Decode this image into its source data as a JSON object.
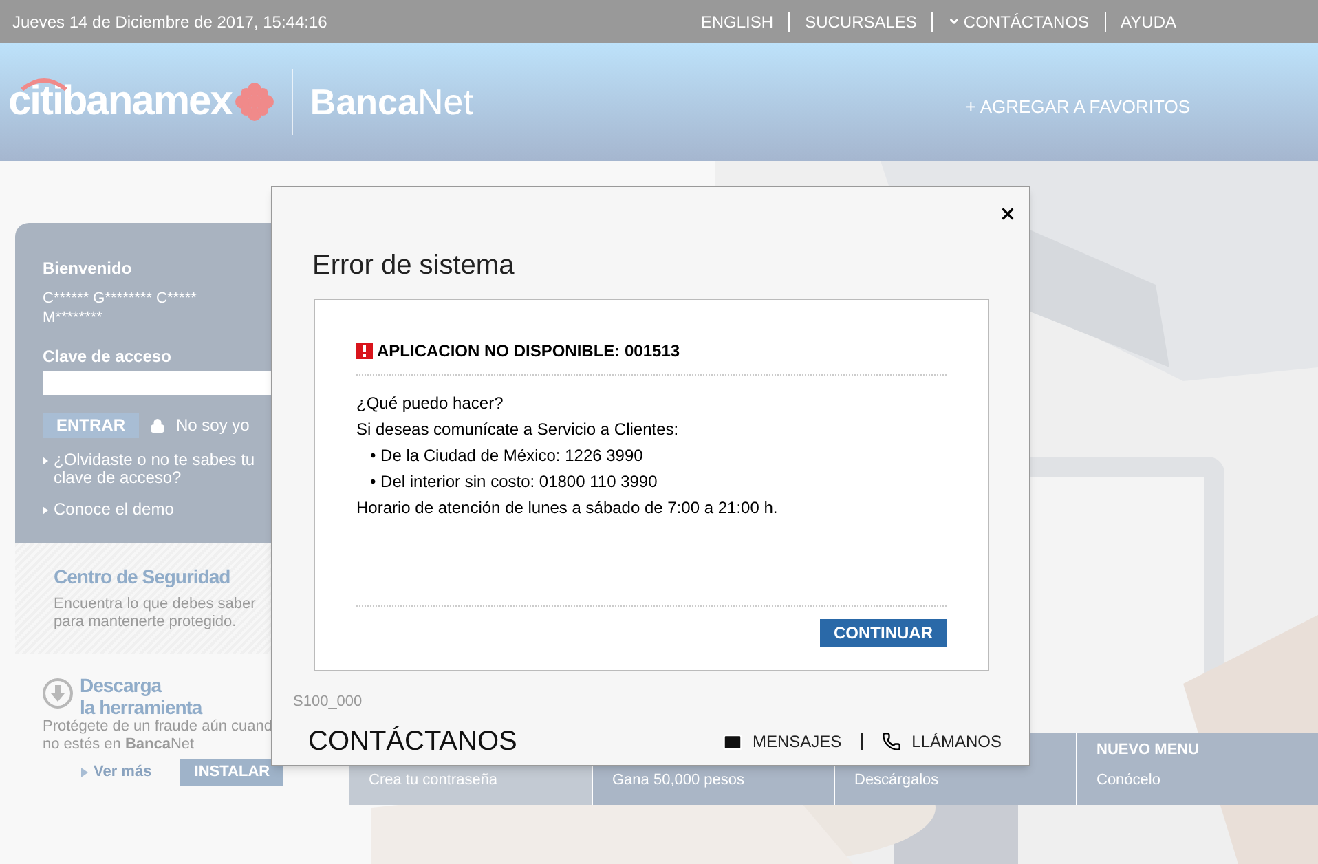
{
  "top_bar": {
    "datetime": "Jueves 14 de Diciembre de 2017, 15:44:16",
    "links": [
      {
        "label": "ENGLISH",
        "has_menu": false
      },
      {
        "label": "SUCURSALES",
        "has_menu": false
      },
      {
        "label": "CONTÁCTANOS",
        "has_menu": true
      },
      {
        "label": "AYUDA",
        "has_menu": false
      }
    ]
  },
  "header": {
    "logo": "citibanamex",
    "product_bold": "Banca",
    "product_light": "Net",
    "favorites": "+ AGREGAR A FAVORITOS"
  },
  "login": {
    "welcome": "Bienvenido",
    "user_name": "C****** G******** C***** M********",
    "password_label": "Clave de acceso",
    "login_button": "ENTRAR",
    "not_me": "No soy yo",
    "links": [
      "¿Olvidaste o no te sabes tu clave de acceso?",
      "Conoce el demo"
    ]
  },
  "security": {
    "title": "Centro de Seguridad",
    "text": "Encuentra lo que debes saber para mantenerte protegido."
  },
  "download": {
    "title_lines": [
      "Descarga",
      "la herramienta"
    ],
    "text_lines": [
      "Protégete de un fraude aún cuand",
      "no estés en **Banca**Net"
    ],
    "see_more": "Ver más",
    "install": "INSTALAR"
  },
  "tiles": [
    {
      "subtitle": "Crea tu contraseña"
    },
    {
      "subtitle": "Gana 50,000 pesos"
    },
    {
      "subtitle": "Descárgalos"
    },
    {
      "title": "NUEVO MENU",
      "subtitle": "Conócelo"
    }
  ],
  "modal": {
    "title": "Error de sistema",
    "error_heading": "APLICACION NO DISPONIBLE: 001513",
    "lines": [
      {
        "kind": "text",
        "text": "¿Qué puedo hacer?"
      },
      {
        "kind": "text",
        "text": "Si deseas comunícate a Servicio a Clientes:"
      },
      {
        "kind": "bullet",
        "text": "• De la Ciudad de México: 1226 3990"
      },
      {
        "kind": "bullet",
        "text": "• Del interior sin costo: 01800 110 3990"
      },
      {
        "kind": "text",
        "text": "Horario de atención de lunes a sábado de 7:00 a 21:00 h."
      }
    ],
    "button": "CONTINUAR",
    "code": "S100_000",
    "footer_title": "CONTÁCTANOS",
    "messages": "MENSAJES",
    "call": "LLÁMANOS"
  }
}
